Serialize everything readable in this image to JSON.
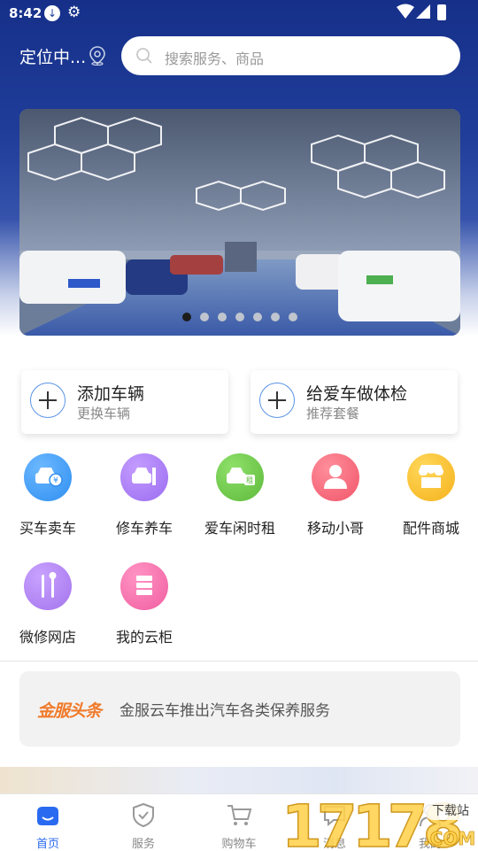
{
  "status_bar": {
    "time": "8:42"
  },
  "header": {
    "location": "定位中...",
    "search_placeholder": "搜索服务、商品"
  },
  "banner": {
    "slide_count": 7,
    "active_slide": 1
  },
  "quick_cards": [
    {
      "title": "添加车辆",
      "subtitle": "更换车辆"
    },
    {
      "title": "给爱车做体检",
      "subtitle": "推荐套餐"
    }
  ],
  "services": [
    {
      "label": "买车卖车",
      "icon": "car-yuan-icon",
      "color": "#2f8ff0"
    },
    {
      "label": "修车养车",
      "icon": "car-wrench-icon",
      "color": "#9a6cf0"
    },
    {
      "label": "爱车闲时租",
      "icon": "car-rent-icon",
      "color": "#5dba3b"
    },
    {
      "label": "移动小哥",
      "icon": "person-icon",
      "color": "#f0566a"
    },
    {
      "label": "配件商城",
      "icon": "store-icon",
      "color": "#f5b21c"
    },
    {
      "label": "微修网店",
      "icon": "tools-icon",
      "color": "#a474ec"
    },
    {
      "label": "我的云柜",
      "icon": "cabinet-icon",
      "color": "#f05ea0"
    }
  ],
  "news": {
    "brand": "金服头条",
    "text": "金服云车推出汽车各类保养服务"
  },
  "tabs": [
    {
      "label": "首页",
      "icon": "home-icon",
      "active": true
    },
    {
      "label": "服务",
      "icon": "shield-icon",
      "active": false
    },
    {
      "label": "购物车",
      "icon": "cart-icon",
      "active": false
    },
    {
      "label": "消息",
      "icon": "message-icon",
      "active": false
    },
    {
      "label": "我的",
      "icon": "user-icon",
      "active": false
    }
  ],
  "watermark": {
    "text": "17178",
    "suffix": "下载站",
    "domain": ".COM"
  },
  "colors": {
    "header_blue": "#1f3d99",
    "accent": "#2a6af0",
    "brand_orange": "#f07a2a"
  }
}
